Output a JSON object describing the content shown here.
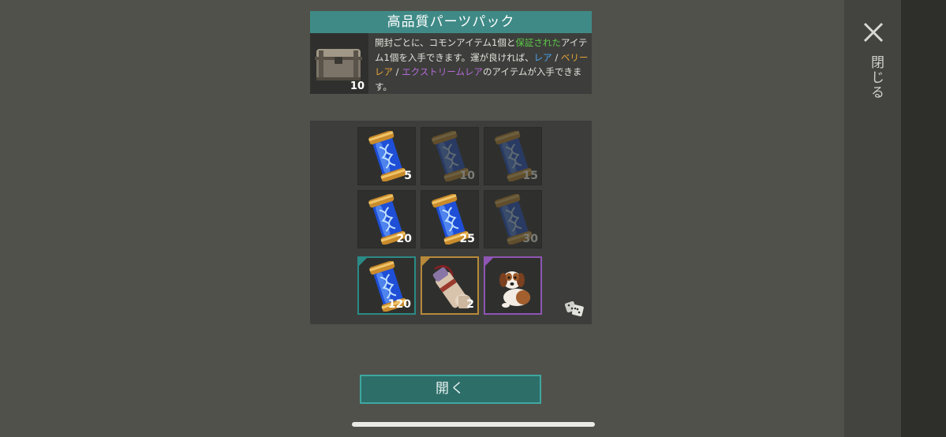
{
  "pack": {
    "title": "高品質パーツパック",
    "count": "10",
    "description": [
      {
        "text": "開封ごとに、コモンアイテム1個と",
        "tone": "plain"
      },
      {
        "text": "保証された",
        "tone": "green"
      },
      {
        "text": "アイテム1個を入手できます。運が良ければ、",
        "tone": "plain"
      },
      {
        "text": "レア",
        "tone": "blue"
      },
      {
        "text": " / ",
        "tone": "plain"
      },
      {
        "text": "ベリーレア",
        "tone": "orange"
      },
      {
        "text": " / ",
        "tone": "plain"
      },
      {
        "text": "エクストリームレア",
        "tone": "purple"
      },
      {
        "text": "のアイテムが入手できます。",
        "tone": "plain"
      }
    ]
  },
  "rewards": [
    {
      "item": "dna-capsule",
      "amount": "5",
      "unlocked": true,
      "rarity": "common"
    },
    {
      "item": "dna-capsule",
      "amount": "10",
      "unlocked": false,
      "rarity": "common"
    },
    {
      "item": "dna-capsule",
      "amount": "15",
      "unlocked": false,
      "rarity": "common"
    },
    {
      "item": "dna-capsule",
      "amount": "20",
      "unlocked": true,
      "rarity": "common"
    },
    {
      "item": "dna-capsule",
      "amount": "25",
      "unlocked": true,
      "rarity": "common"
    },
    {
      "item": "dna-capsule",
      "amount": "30",
      "unlocked": false,
      "rarity": "common"
    },
    {
      "item": "dna-capsule",
      "amount": "120",
      "unlocked": true,
      "rarity": "teal"
    },
    {
      "item": "blueprint-scroll",
      "amount": "2",
      "unlocked": true,
      "rarity": "gold"
    },
    {
      "item": "dog",
      "amount": "",
      "unlocked": true,
      "rarity": "purple"
    }
  ],
  "open_button": {
    "label": "開く"
  },
  "close": {
    "label": "閉じる"
  },
  "colors": {
    "accent_teal": "#3f8a86",
    "guaranteed_green": "#5cc94a",
    "rare_blue": "#4da3f0",
    "very_rare_orange": "#e8a33a",
    "extreme_purple": "#b46ad8"
  },
  "icons": {
    "close": "close-x-icon",
    "dice": "dice-icon",
    "chest": "chest-icon"
  }
}
